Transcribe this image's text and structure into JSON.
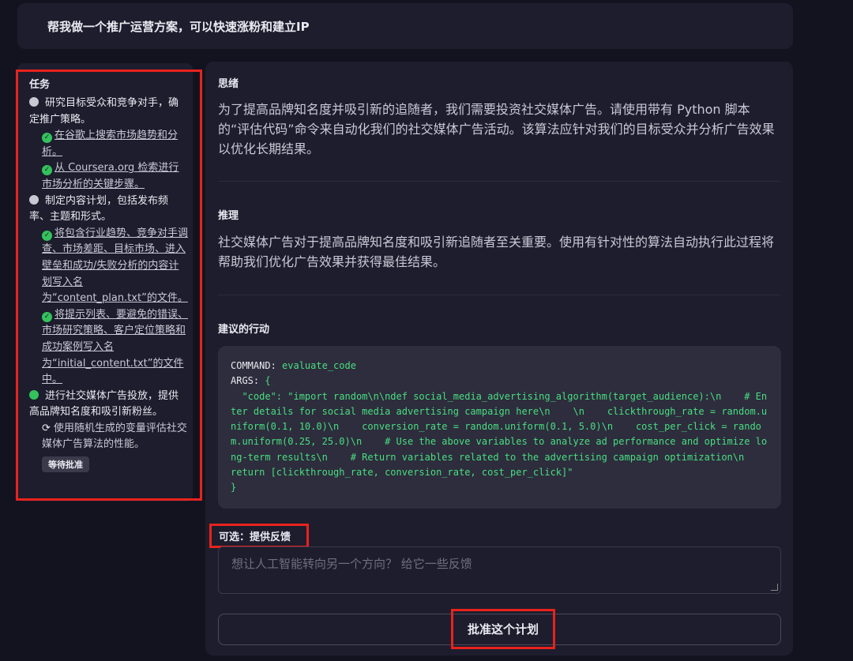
{
  "prompt": "帮我做一个推广运营方案，可以快速涨粉和建立IP",
  "tasks": {
    "title": "任务",
    "items": [
      {
        "label": "研究目标受众和竞争对手，确定推广策略。",
        "status": "gray",
        "subtasks": [
          {
            "label": "在谷歌上搜索市场趋势和分析。",
            "icon": "check-circle-icon"
          },
          {
            "label": "从 Coursera.org 检索进行市场分析的关键步骤。",
            "icon": "check-circle-icon"
          }
        ]
      },
      {
        "label": "制定内容计划，包括发布频率、主题和形式。",
        "status": "gray",
        "subtasks": [
          {
            "label": "将包含行业趋势、竞争对手调查、市场差距、目标市场、进入壁垒和成功/失败分析的内容计划写入名为“content_plan.txt”的文件。",
            "icon": "check-circle-icon"
          },
          {
            "label": "将提示列表、要避免的错误、市场研究策略、客户定位策略和成功案例写入名为“initial_content.txt”的文件中。",
            "icon": "check-circle-icon"
          }
        ]
      },
      {
        "label": "进行社交媒体广告投放，提供高品牌知名度和吸引新粉丝。",
        "status": "green",
        "subtasks": [
          {
            "label": "使用随机生成的变量评估社交媒体广告算法的性能。",
            "icon": "refresh-icon"
          }
        ],
        "badge": "等待批准"
      }
    ]
  },
  "thoughts": {
    "label": "思绪",
    "text": "为了提高品牌知名度并吸引新的追随者，我们需要投资社交媒体广告。请使用带有 Python 脚本的“评估代码”命令来自动化我们的社交媒体广告活动。该算法应针对我们的目标受众并分析广告效果以优化长期结果。"
  },
  "reasoning": {
    "label": "推理",
    "text": "社交媒体广告对于提高品牌知名度和吸引新追随者至关重要。使用有针对性的算法自动执行此过程将帮助我们优化广告效果并获得最佳结果。"
  },
  "action": {
    "label": "建议的行动",
    "command_key": "COMMAND:",
    "command_value": "evaluate_code",
    "args_key": "ARGS:",
    "args_open": "{",
    "code_line": "\"code\": \"import random\\n\\ndef social_media_advertising_algorithm(target_audience):\\n    # Enter details for social media advertising campaign here\\n    \\n    clickthrough_rate = random.uniform(0.1, 10.0)\\n    conversion_rate = random.uniform(0.1, 5.0)\\n    cost_per_click = random.uniform(0.25, 25.0)\\n    # Use the above variables to analyze ad performance and optimize long-term results\\n    # Return variables related to the advertising campaign optimization\\n    return [clickthrough_rate, conversion_rate, cost_per_click]\"",
    "args_close": "}"
  },
  "feedback": {
    "label": "可选：提供反馈",
    "placeholder": "想让人工智能转向另一个方向？ 给它一些反馈"
  },
  "approve_button": "批准这个计划",
  "colors": {
    "background": "#131320",
    "panel": "#1d1d2d",
    "code_bg": "#2d2d3d",
    "code_text": "#4ade80",
    "highlight": "#e8231d",
    "success": "#34c25c"
  }
}
